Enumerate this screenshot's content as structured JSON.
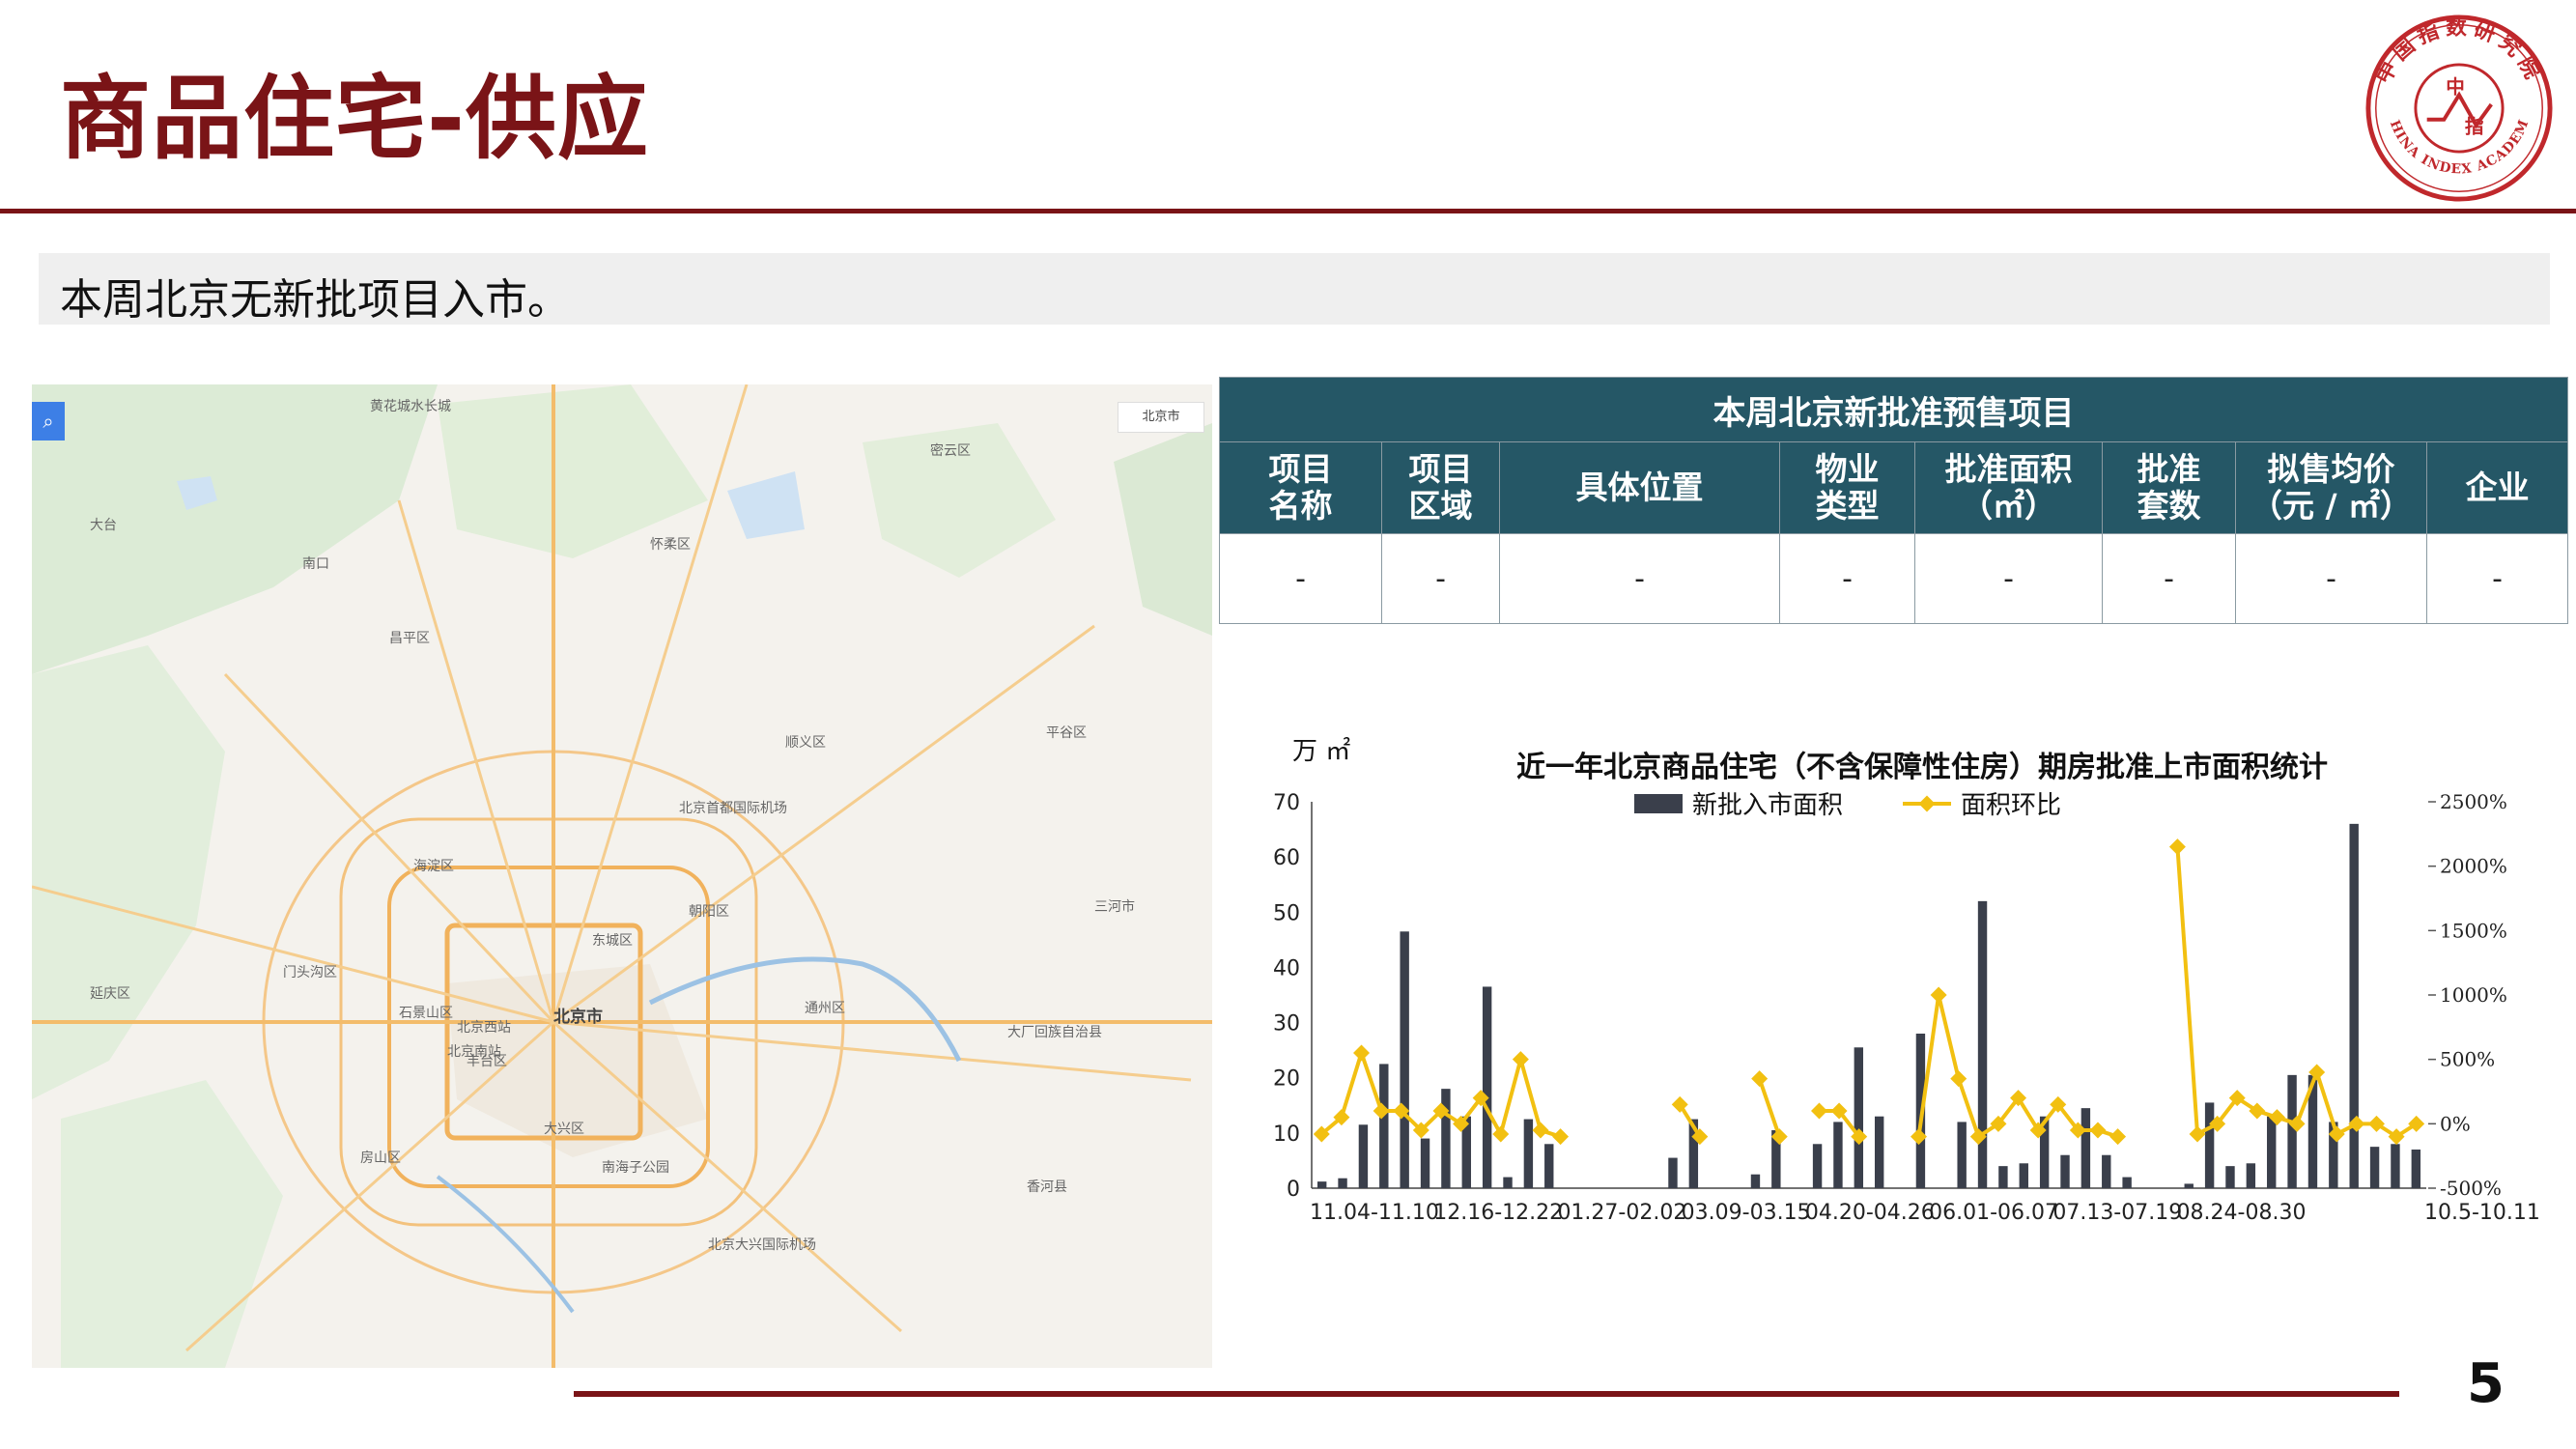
{
  "page": {
    "title": "商品住宅-供应",
    "summary": "本周北京无新批项目入市。",
    "page_number": "5"
  },
  "logo": {
    "text_top": "中国指数研究院",
    "text_bottom": "CHINA INDEX ACADEMY",
    "center_top": "中",
    "center_bottom": "指",
    "color": "#c0282c"
  },
  "map": {
    "city_select": "北京市",
    "labels": [
      {
        "name": "黄花城水长城",
        "cls": ""
      },
      {
        "name": "延庆区",
        "cls": ""
      },
      {
        "name": "昌平区",
        "cls": ""
      },
      {
        "name": "怀柔区",
        "cls": ""
      },
      {
        "name": "密云区",
        "cls": ""
      },
      {
        "name": "平谷区",
        "cls": ""
      },
      {
        "name": "顺义区",
        "cls": ""
      },
      {
        "name": "海淀区",
        "cls": ""
      },
      {
        "name": "门头沟区",
        "cls": ""
      },
      {
        "name": "朝阳区",
        "cls": ""
      },
      {
        "name": "北京市",
        "cls": "city"
      },
      {
        "name": "石景山区",
        "cls": ""
      },
      {
        "name": "丰台区",
        "cls": ""
      },
      {
        "name": "东城区",
        "cls": ""
      },
      {
        "name": "通州区",
        "cls": ""
      },
      {
        "name": "三河市",
        "cls": ""
      },
      {
        "name": "大厂回族自治县",
        "cls": ""
      },
      {
        "name": "大兴区",
        "cls": ""
      },
      {
        "name": "房山区",
        "cls": ""
      },
      {
        "name": "香河县",
        "cls": ""
      },
      {
        "name": "北京首都国际机场",
        "cls": ""
      },
      {
        "name": "北京大兴国际机场",
        "cls": ""
      },
      {
        "name": "南海子公园",
        "cls": ""
      },
      {
        "name": "北京南站",
        "cls": ""
      },
      {
        "name": "北京西站",
        "cls": ""
      },
      {
        "name": "南口",
        "cls": ""
      },
      {
        "name": "大台",
        "cls": ""
      }
    ]
  },
  "table": {
    "caption": "本周北京新批准预售项目",
    "headers": [
      "项目\n名称",
      "项目\n区域",
      "具体位置",
      "物业\n类型",
      "批准面积\n（㎡）",
      "批准\n套数",
      "拟售均价\n（元 / ㎡）",
      "企业"
    ],
    "rows": [
      [
        "-",
        "-",
        "-",
        "-",
        "-",
        "-",
        "-",
        "-"
      ]
    ],
    "header_color": "#255766"
  },
  "chart_data": {
    "type": "bar",
    "title": "近一年北京商品住宅（不含保障性住房）期房批准上市面积统计",
    "ylabel": "万 ㎡",
    "ylim": [
      0,
      70
    ],
    "yticks": [
      0,
      10,
      20,
      30,
      40,
      50,
      60,
      70
    ],
    "y2lim": [
      -500,
      2500
    ],
    "y2ticks": [
      "-500%",
      "0%",
      "500%",
      "1000%",
      "1500%",
      "2000%",
      "2500%"
    ],
    "legend": [
      "新批入市面积",
      "面积环比"
    ],
    "xtick_labels": [
      "11.04-11.10",
      "12.16-12.22",
      "01.27-02.02",
      "03.09-03.15",
      "04.20-04.26",
      "06.01-06.07",
      "07.13-07.19",
      "08.24-08.30",
      "10.5-10.11"
    ],
    "bar_color": "#3a3f4b",
    "line_color": "#f2c011",
    "weeks": 52,
    "series": [
      {
        "name": "新批入市面积",
        "type": "bar",
        "values": [
          1.2,
          1.8,
          11.5,
          22.5,
          46.5,
          9.0,
          18.0,
          13.0,
          36.5,
          2.0,
          12.5,
          8.0,
          0,
          0,
          0,
          0,
          0,
          5.5,
          12.5,
          0,
          0,
          2.5,
          10.5,
          0,
          8.0,
          12.0,
          25.5,
          13.0,
          0,
          28.0,
          0,
          12.0,
          52.0,
          4.0,
          4.5,
          13.0,
          6.0,
          14.5,
          6.0,
          2.0,
          0,
          0,
          0.8,
          15.5,
          4.0,
          4.5,
          13.0,
          20.5,
          20.5,
          12.0,
          66.0,
          7.5,
          8.0,
          7.0
        ]
      },
      {
        "name": "面积环比",
        "type": "line",
        "axis": "y2",
        "values": [
          -80,
          50,
          550,
          100,
          100,
          -50,
          100,
          0,
          200,
          -80,
          500,
          -50,
          -100,
          null,
          null,
          null,
          null,
          null,
          150,
          -100,
          null,
          null,
          350,
          -100,
          null,
          100,
          100,
          -100,
          null,
          null,
          -100,
          1000,
          350,
          -100,
          0,
          200,
          -50,
          150,
          -50,
          -50,
          -100,
          null,
          null,
          2150,
          -80,
          0,
          200,
          100,
          50,
          0,
          400,
          -80,
          0,
          0,
          -100,
          0
        ]
      }
    ]
  }
}
